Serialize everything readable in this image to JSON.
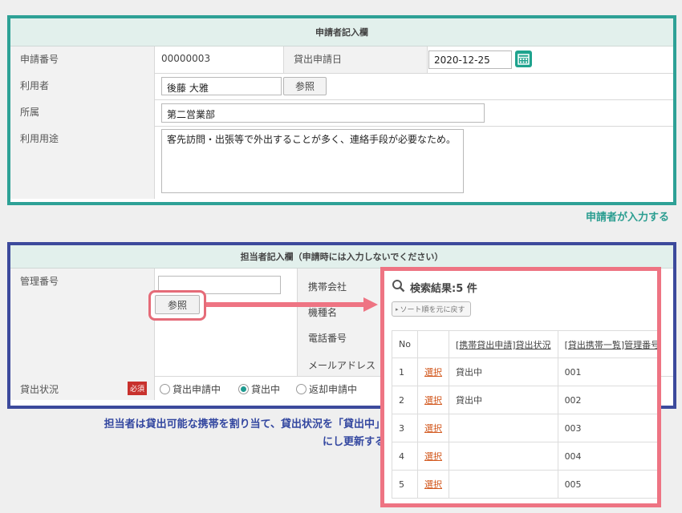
{
  "applicant_section": {
    "title": "申請者記入欄",
    "application_no_label": "申請番号",
    "application_no_value": "00000003",
    "lend_date_label": "貸出申請日",
    "lend_date_value": "2020-12-25",
    "user_label": "利用者",
    "user_value": "後藤 大雅",
    "ref_button": "参照",
    "dept_label": "所属",
    "dept_value": "第二営業部",
    "purpose_label": "利用用途",
    "purpose_value": "客先訪問・出張等で外出することが多く、連絡手段が必要なため。",
    "caption": "申請者が入力する"
  },
  "staff_section": {
    "title": "担当者記入欄（申請時には入力しないでください）",
    "mgmt_no_label": "管理番号",
    "mgmt_no_value": "",
    "ref_button": "参照",
    "carrier_label": "携帯会社",
    "model_label": "機種名",
    "phone_label": "電話番号",
    "mail_label": "メールアドレス",
    "status_label": "貸出状況",
    "required_badge": "必須",
    "status_options": [
      "貸出申請中",
      "貸出中",
      "返却申請中"
    ],
    "status_selected": "貸出中",
    "caption_line1": "担当者は貸出可能な携帯を割り当て、貸出状況を「貸出中」",
    "caption_line2": "にし更新する"
  },
  "search_result": {
    "title": "検索結果:5 件",
    "reset_sort": "ソート順を元に戻す",
    "columns": [
      "No",
      "",
      "[携帯貸出申請]貸出状況",
      "[貸出携帯一覧]管理番号"
    ],
    "select_label": "選択",
    "rows": [
      {
        "no": "1",
        "status": "貸出中",
        "mgmt": "001"
      },
      {
        "no": "2",
        "status": "貸出中",
        "mgmt": "002"
      },
      {
        "no": "3",
        "status": "",
        "mgmt": "003"
      },
      {
        "no": "4",
        "status": "",
        "mgmt": "004"
      },
      {
        "no": "5",
        "status": "",
        "mgmt": "005"
      }
    ]
  },
  "colors": {
    "applicant_border": "#2ea196",
    "staff_border": "#3c4a9c",
    "highlight": "#ee7483",
    "link": "#d2571c"
  }
}
